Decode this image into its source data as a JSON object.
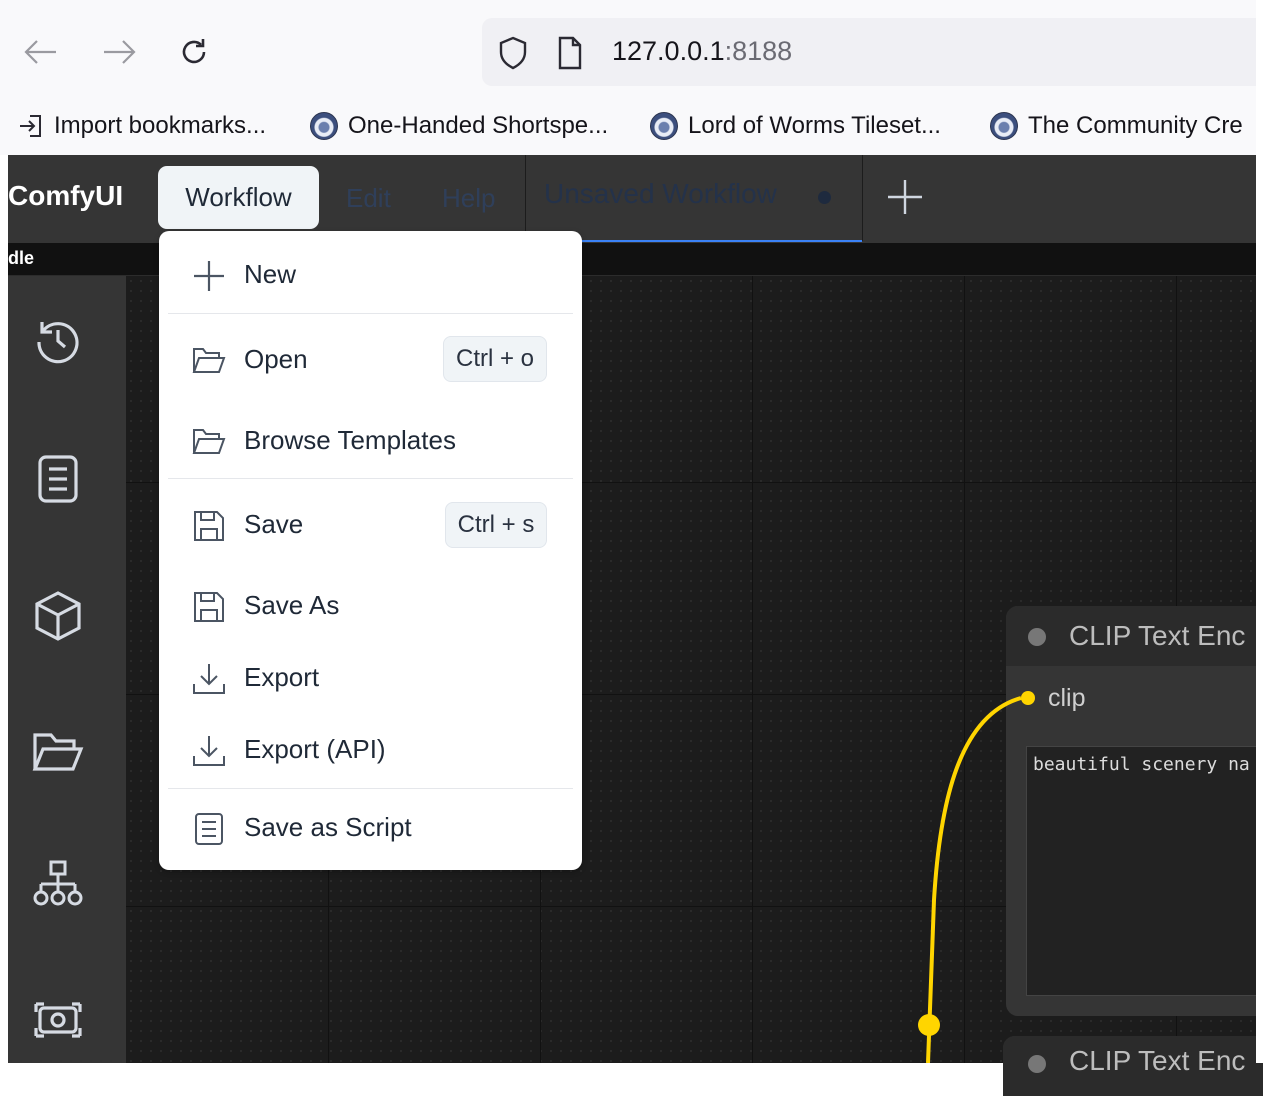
{
  "browser": {
    "url_host": "127.0.0.1",
    "url_port": ":8188",
    "bookmarks": [
      {
        "label": "Import bookmarks..."
      },
      {
        "label": "One-Handed Shortspe..."
      },
      {
        "label": "Lord of Worms Tileset..."
      },
      {
        "label": "The Community Cre"
      }
    ]
  },
  "app": {
    "brand": "ComfyUI",
    "menus": [
      "Workflow",
      "Edit",
      "Help"
    ],
    "tab_title": "Unsaved Workflow",
    "queue_status": "dle"
  },
  "workflow_menu": {
    "items": [
      {
        "label": "New",
        "icon": "plus-icon"
      },
      {
        "label": "Open",
        "icon": "folder-open-icon",
        "shortcut": "Ctrl + o"
      },
      {
        "label": "Browse Templates",
        "icon": "folder-open-icon"
      },
      {
        "label": "Save",
        "icon": "floppy-icon",
        "shortcut": "Ctrl + s"
      },
      {
        "label": "Save As",
        "icon": "floppy-icon"
      },
      {
        "label": "Export",
        "icon": "download-icon"
      },
      {
        "label": "Export (API)",
        "icon": "download-icon"
      },
      {
        "label": "Save as Script",
        "icon": "document-icon"
      }
    ]
  },
  "sidebar": {
    "items": [
      {
        "icon": "history-icon"
      },
      {
        "icon": "document-list-icon"
      },
      {
        "icon": "cube-icon"
      },
      {
        "icon": "folder-open-icon"
      },
      {
        "icon": "sitemap-icon"
      },
      {
        "icon": "image-gallery-icon"
      }
    ]
  },
  "nodes": [
    {
      "title": "CLIP Text Enc",
      "input": "clip",
      "text": "beautiful scenery na"
    },
    {
      "title": "CLIP Text Enc"
    }
  ],
  "colors": {
    "canvas": "#1c1c1c",
    "panel": "#353535",
    "link_clip": "#ffd500",
    "menu_bg": "#ffffff"
  }
}
